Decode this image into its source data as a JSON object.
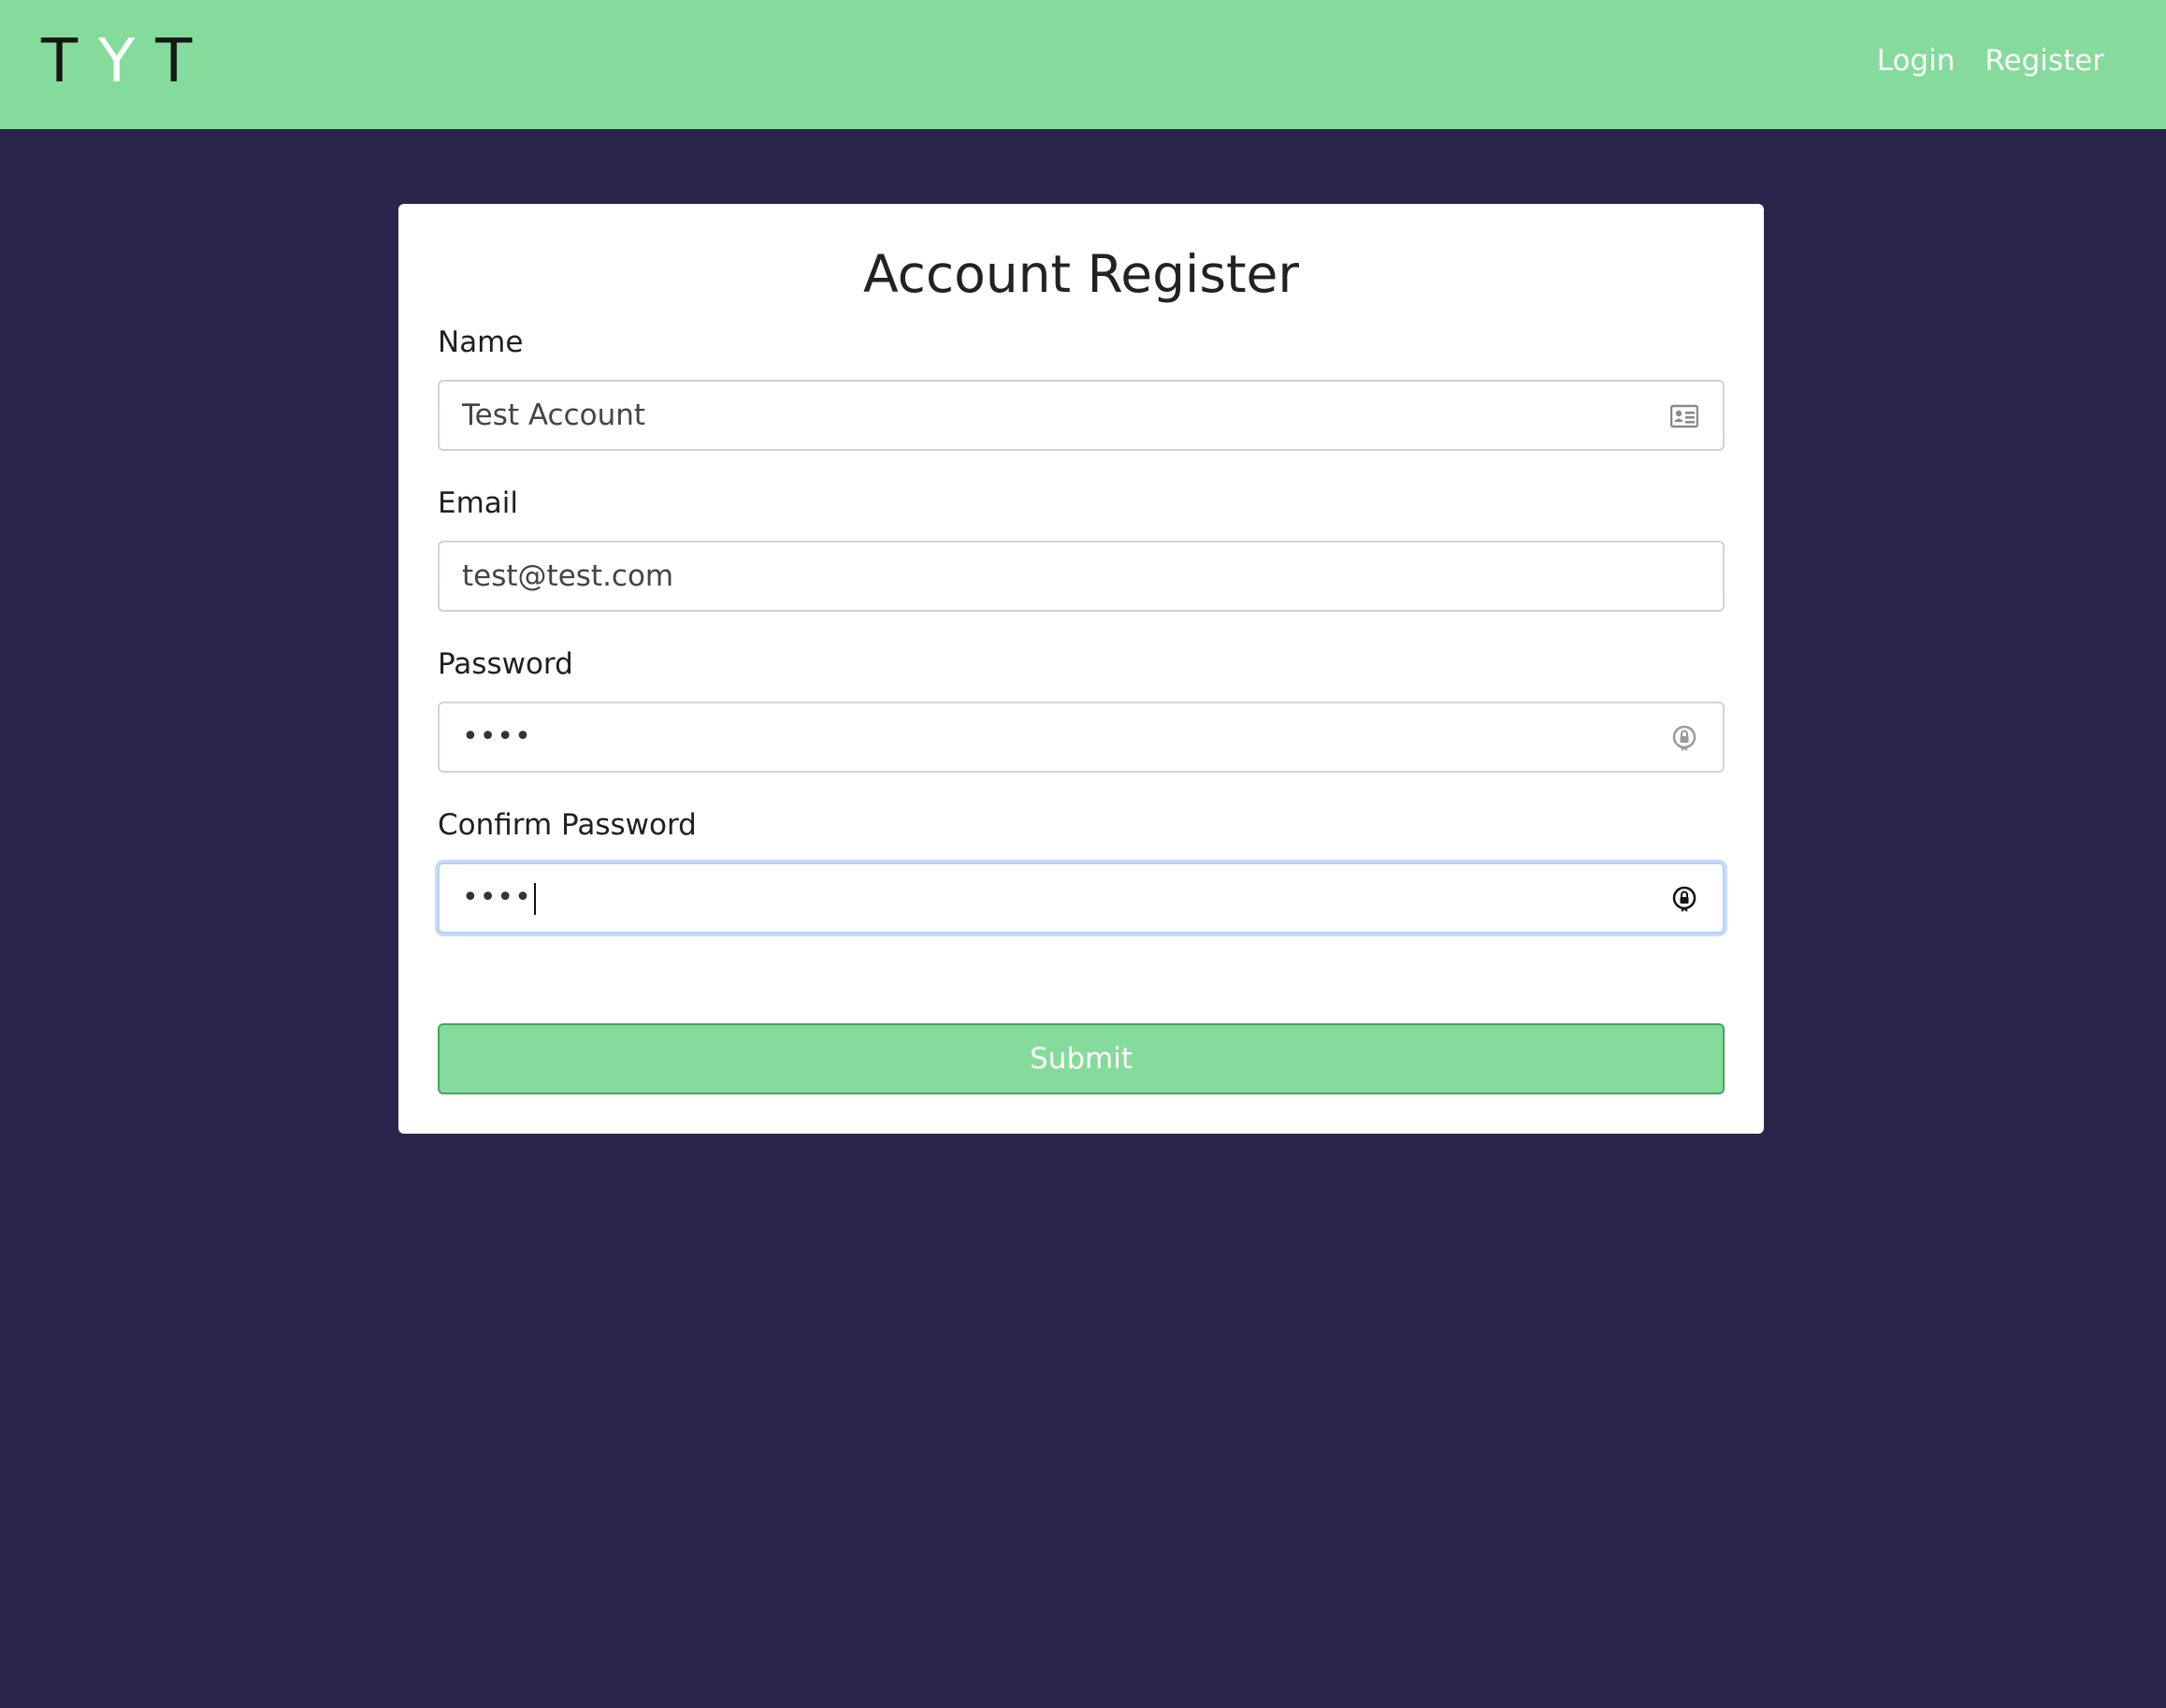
{
  "navbar": {
    "brand_chars": [
      "T",
      "Y",
      "T"
    ],
    "links": [
      {
        "label": "Login"
      },
      {
        "label": "Register"
      }
    ]
  },
  "form": {
    "title": "Account Register",
    "fields": {
      "name": {
        "label": "Name",
        "value": "Test Account",
        "icon": "contact-card-icon"
      },
      "email": {
        "label": "Email",
        "value": "test@test.com"
      },
      "password": {
        "label": "Password",
        "masked_value": "••••",
        "icon": "password-key-icon"
      },
      "confirm_password": {
        "label": "Confirm Password",
        "masked_value": "••••",
        "icon": "password-key-icon",
        "focused": true
      }
    },
    "submit_label": "Submit"
  },
  "colors": {
    "navbar_bg": "#85db9b",
    "page_bg": "#2a264b",
    "card_bg": "#ffffff",
    "submit_bg": "#85db9b",
    "submit_border": "#3fa85a",
    "focus_ring": "#c8dcf8"
  }
}
